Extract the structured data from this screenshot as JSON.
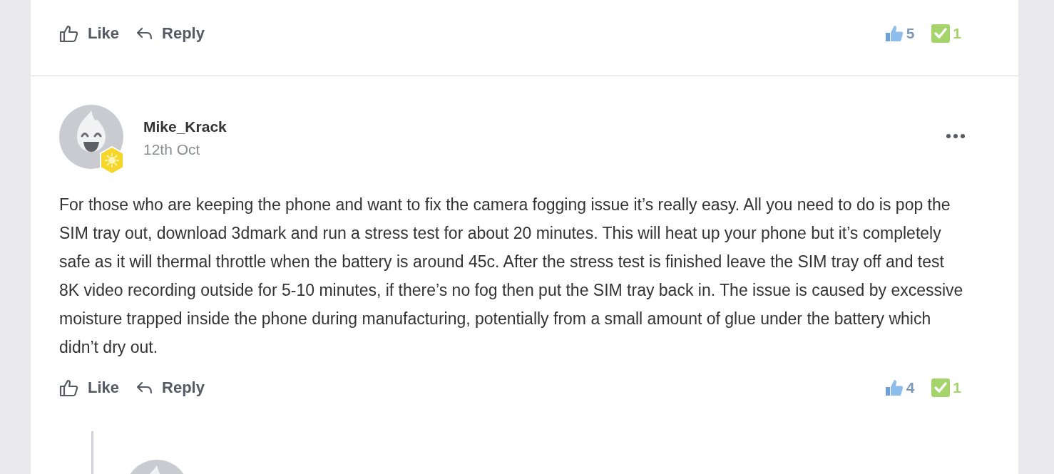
{
  "previous_post": {
    "actions": [
      {
        "kind": "like",
        "label": "Like"
      },
      {
        "kind": "reply",
        "label": "Reply"
      }
    ],
    "kudos_count": "5",
    "solutions_count": "1"
  },
  "post": {
    "author": "Mike_Krack",
    "date": "12th Oct",
    "body": "For those who are keeping the phone and want to fix the camera fogging issue it’s really easy. All you need to do is pop the SIM tray out, download 3dmark and run a stress test for about 20 minutes. This will heat up your phone but it’s completely safe as it will thermal throttle when the battery is around 45c. After the stress test is finished leave the SIM tray off and test 8K video recording outside for 5-10 minutes, if there’s no fog then put the SIM tray back in. The issue is caused by excessive moisture trapped inside the phone during manufacturing, potentially from a small amount of glue under the battery which didn’t dry out.",
    "actions": [
      {
        "kind": "like",
        "label": "Like"
      },
      {
        "kind": "reply",
        "label": "Reply"
      }
    ],
    "kudos_count": "4",
    "solutions_count": "1"
  }
}
